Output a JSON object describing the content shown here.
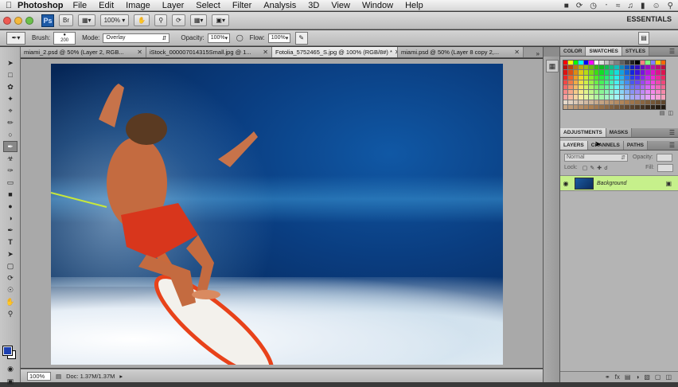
{
  "menubar": {
    "app_name": "Photoshop",
    "menus": [
      "File",
      "Edit",
      "Image",
      "Layer",
      "Select",
      "Filter",
      "Analysis",
      "3D",
      "View",
      "Window",
      "Help"
    ]
  },
  "appbar": {
    "logo": "Ps",
    "zoom": "100%",
    "workspace": "ESSENTIALS"
  },
  "options": {
    "brush_label": "Brush:",
    "brush_size": "200",
    "mode_label": "Mode:",
    "mode_value": "Overlay",
    "opacity_label": "Opacity:",
    "opacity_value": "100%",
    "flow_label": "Flow:",
    "flow_value": "100%"
  },
  "tabs": [
    {
      "label": "miami_2.psd @ 50% (Layer 2, RGB..."
    },
    {
      "label": "iStock_000007014315Small.jpg @ 1..."
    },
    {
      "label": "Fotolia_5752465_S.jpg @ 100% (RGB/8#) *"
    },
    {
      "label": "miami.psd @ 50% (Layer 8 copy 2,..."
    }
  ],
  "statusbar": {
    "zoom": "100%",
    "doc": "Doc: 1.37M/1.37M"
  },
  "panels": {
    "top_tabs": [
      "COLOR",
      "SWATCHES",
      "STYLES"
    ],
    "adj_tabs": [
      "ADJUSTMENTS",
      "MASKS"
    ],
    "layer_tabs": [
      "LAYERS",
      "CHANNELS",
      "PATHS"
    ],
    "blend_mode": "Normal",
    "opacity_label": "Opacity:",
    "lock_label": "Lock:",
    "fill_label": "Fill:",
    "layer_name": "Background"
  },
  "colors": {
    "accent_layer": "#c6f08b",
    "foreground": "#1c3fb0",
    "background": "#ffffff"
  }
}
